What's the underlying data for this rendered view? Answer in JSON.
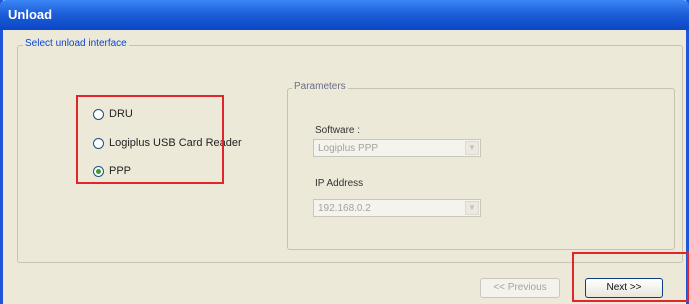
{
  "window": {
    "title": "Unload"
  },
  "interface_group": {
    "legend": "Select unload interface",
    "options": [
      {
        "label": "DRU",
        "selected": false
      },
      {
        "label": "Logiplus USB Card Reader",
        "selected": false
      },
      {
        "label": "PPP",
        "selected": true
      }
    ]
  },
  "parameters": {
    "legend": "Parameters",
    "software_label": "Software :",
    "software_value": "Logiplus PPP",
    "ip_label": "IP Address",
    "ip_value": "192.168.0.2"
  },
  "buttons": {
    "previous": "<< Previous",
    "next": "Next >>"
  },
  "colors": {
    "titlebar": "#1d5fd9",
    "highlight": "#e0262b",
    "legend": "#0a46d4"
  }
}
